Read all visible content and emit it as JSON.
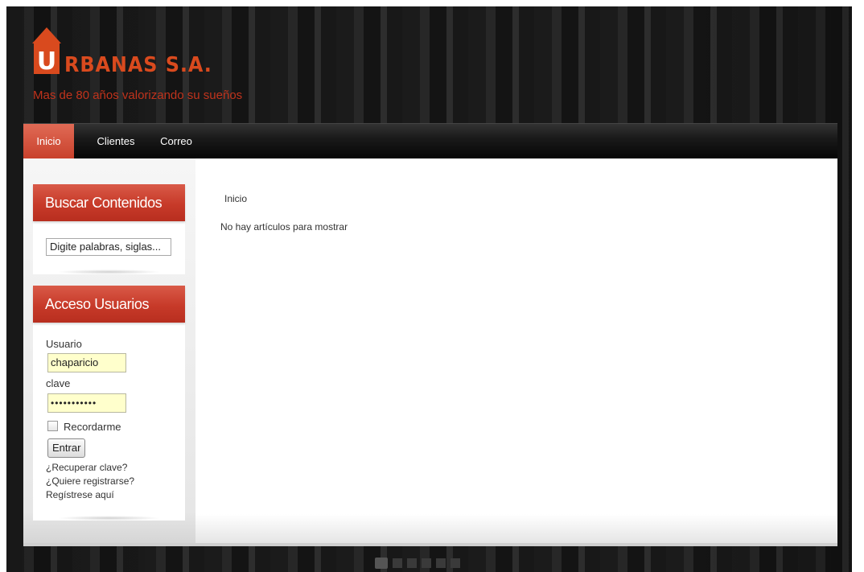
{
  "site": {
    "brand": "RBANAS S.A.",
    "tagline": "Mas de 80 años valorizando su sueños",
    "logo_initial": "U"
  },
  "nav": {
    "items": [
      {
        "label": "Inicio",
        "active": true
      },
      {
        "label": "Clientes",
        "active": false
      },
      {
        "label": "Correo",
        "active": false
      }
    ]
  },
  "search_module": {
    "title": "Buscar Contenidos",
    "input_value": "Digite palabras, siglas..."
  },
  "login_module": {
    "title": "Acceso Usuarios",
    "username_label": "Usuario",
    "username_value": "chaparicio",
    "password_label": "clave",
    "password_value": "•••••••••••",
    "remember_label": "Recordarme",
    "submit_label": "Entrar",
    "links": [
      "¿Recuperar clave?",
      "¿Quiere registrarse?",
      "Regístrese aquí"
    ]
  },
  "main": {
    "breadcrumb": "Inicio",
    "message": "No hay artículos para mostrar"
  },
  "colors": {
    "accent": "#c73a29",
    "brand_orange": "#d94a1e",
    "input_highlight": "#ffffcc"
  }
}
